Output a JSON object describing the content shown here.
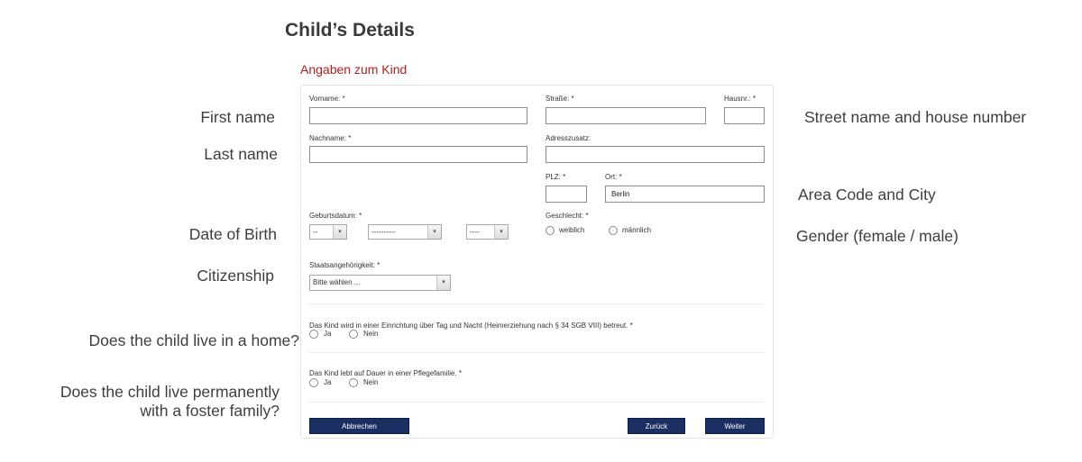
{
  "page_title": "Child’s Details",
  "section_title": "Angaben zum Kind",
  "form": {
    "vorname_label": "Vorname: *",
    "vorname_value": "",
    "nachname_label": "Nachname: *",
    "nachname_value": "",
    "strasse_label": "Straße: *",
    "strasse_value": "",
    "hausnr_label": "Hausnr.: *",
    "hausnr_value": "",
    "adresszusatz_label": "Adresszusatz:",
    "adresszusatz_value": "",
    "plz_label": "PLZ: *",
    "plz_value": "",
    "ort_label": "Ort: *",
    "ort_value": "Berlin",
    "geburtsdatum_label": "Geburtsdatum: *",
    "day_selected": "--",
    "month_selected": "----------",
    "year_selected": "----",
    "geschlecht_label": "Geschlecht: *",
    "gender_options": [
      "weiblich",
      "männlich"
    ],
    "staat_label": "Staatsangehörigkeit: *",
    "staat_selected": "Bitte wählen ...",
    "question1": "Das Kind wird in einer Einrichtung über Tag und Nacht (Heimerziehung nach § 34 SGB VIII) betreut. *",
    "question2": "Das Kind lebt auf Dauer in einer Pflegefamilie. *",
    "yes_label": "Ja",
    "no_label": "Nein",
    "cancel_button": "Abbrechen",
    "back_button": "Zurück",
    "next_button": "Weiter"
  },
  "annotations": {
    "first_name": "First name",
    "last_name": "Last name",
    "date_of_birth": "Date of Birth",
    "citizenship": "Citizenship",
    "lives_in_home": "Does the child live in a home?",
    "foster_line1": "Does the child live permanently",
    "foster_line2": "with a foster family?",
    "street": "Street name and house number",
    "area_code_city": "Area Code and City",
    "gender": "Gender (female / male)"
  },
  "colors": {
    "section_title": "#b0201f",
    "button_bg": "#1b2f63"
  }
}
